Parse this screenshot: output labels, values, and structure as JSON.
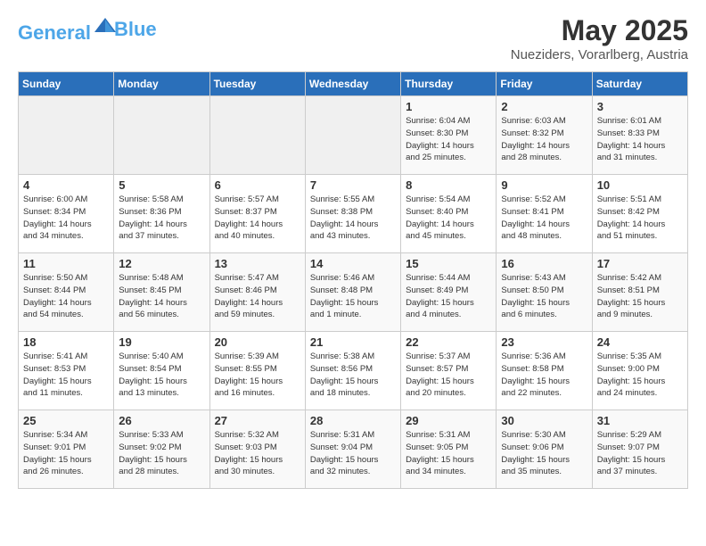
{
  "header": {
    "logo_line1": "General",
    "logo_line2": "Blue",
    "month": "May 2025",
    "location": "Nueziders, Vorarlberg, Austria"
  },
  "weekdays": [
    "Sunday",
    "Monday",
    "Tuesday",
    "Wednesday",
    "Thursday",
    "Friday",
    "Saturday"
  ],
  "weeks": [
    [
      {
        "day": "",
        "info": ""
      },
      {
        "day": "",
        "info": ""
      },
      {
        "day": "",
        "info": ""
      },
      {
        "day": "",
        "info": ""
      },
      {
        "day": "1",
        "info": "Sunrise: 6:04 AM\nSunset: 8:30 PM\nDaylight: 14 hours\nand 25 minutes."
      },
      {
        "day": "2",
        "info": "Sunrise: 6:03 AM\nSunset: 8:32 PM\nDaylight: 14 hours\nand 28 minutes."
      },
      {
        "day": "3",
        "info": "Sunrise: 6:01 AM\nSunset: 8:33 PM\nDaylight: 14 hours\nand 31 minutes."
      }
    ],
    [
      {
        "day": "4",
        "info": "Sunrise: 6:00 AM\nSunset: 8:34 PM\nDaylight: 14 hours\nand 34 minutes."
      },
      {
        "day": "5",
        "info": "Sunrise: 5:58 AM\nSunset: 8:36 PM\nDaylight: 14 hours\nand 37 minutes."
      },
      {
        "day": "6",
        "info": "Sunrise: 5:57 AM\nSunset: 8:37 PM\nDaylight: 14 hours\nand 40 minutes."
      },
      {
        "day": "7",
        "info": "Sunrise: 5:55 AM\nSunset: 8:38 PM\nDaylight: 14 hours\nand 43 minutes."
      },
      {
        "day": "8",
        "info": "Sunrise: 5:54 AM\nSunset: 8:40 PM\nDaylight: 14 hours\nand 45 minutes."
      },
      {
        "day": "9",
        "info": "Sunrise: 5:52 AM\nSunset: 8:41 PM\nDaylight: 14 hours\nand 48 minutes."
      },
      {
        "day": "10",
        "info": "Sunrise: 5:51 AM\nSunset: 8:42 PM\nDaylight: 14 hours\nand 51 minutes."
      }
    ],
    [
      {
        "day": "11",
        "info": "Sunrise: 5:50 AM\nSunset: 8:44 PM\nDaylight: 14 hours\nand 54 minutes."
      },
      {
        "day": "12",
        "info": "Sunrise: 5:48 AM\nSunset: 8:45 PM\nDaylight: 14 hours\nand 56 minutes."
      },
      {
        "day": "13",
        "info": "Sunrise: 5:47 AM\nSunset: 8:46 PM\nDaylight: 14 hours\nand 59 minutes."
      },
      {
        "day": "14",
        "info": "Sunrise: 5:46 AM\nSunset: 8:48 PM\nDaylight: 15 hours\nand 1 minute."
      },
      {
        "day": "15",
        "info": "Sunrise: 5:44 AM\nSunset: 8:49 PM\nDaylight: 15 hours\nand 4 minutes."
      },
      {
        "day": "16",
        "info": "Sunrise: 5:43 AM\nSunset: 8:50 PM\nDaylight: 15 hours\nand 6 minutes."
      },
      {
        "day": "17",
        "info": "Sunrise: 5:42 AM\nSunset: 8:51 PM\nDaylight: 15 hours\nand 9 minutes."
      }
    ],
    [
      {
        "day": "18",
        "info": "Sunrise: 5:41 AM\nSunset: 8:53 PM\nDaylight: 15 hours\nand 11 minutes."
      },
      {
        "day": "19",
        "info": "Sunrise: 5:40 AM\nSunset: 8:54 PM\nDaylight: 15 hours\nand 13 minutes."
      },
      {
        "day": "20",
        "info": "Sunrise: 5:39 AM\nSunset: 8:55 PM\nDaylight: 15 hours\nand 16 minutes."
      },
      {
        "day": "21",
        "info": "Sunrise: 5:38 AM\nSunset: 8:56 PM\nDaylight: 15 hours\nand 18 minutes."
      },
      {
        "day": "22",
        "info": "Sunrise: 5:37 AM\nSunset: 8:57 PM\nDaylight: 15 hours\nand 20 minutes."
      },
      {
        "day": "23",
        "info": "Sunrise: 5:36 AM\nSunset: 8:58 PM\nDaylight: 15 hours\nand 22 minutes."
      },
      {
        "day": "24",
        "info": "Sunrise: 5:35 AM\nSunset: 9:00 PM\nDaylight: 15 hours\nand 24 minutes."
      }
    ],
    [
      {
        "day": "25",
        "info": "Sunrise: 5:34 AM\nSunset: 9:01 PM\nDaylight: 15 hours\nand 26 minutes."
      },
      {
        "day": "26",
        "info": "Sunrise: 5:33 AM\nSunset: 9:02 PM\nDaylight: 15 hours\nand 28 minutes."
      },
      {
        "day": "27",
        "info": "Sunrise: 5:32 AM\nSunset: 9:03 PM\nDaylight: 15 hours\nand 30 minutes."
      },
      {
        "day": "28",
        "info": "Sunrise: 5:31 AM\nSunset: 9:04 PM\nDaylight: 15 hours\nand 32 minutes."
      },
      {
        "day": "29",
        "info": "Sunrise: 5:31 AM\nSunset: 9:05 PM\nDaylight: 15 hours\nand 34 minutes."
      },
      {
        "day": "30",
        "info": "Sunrise: 5:30 AM\nSunset: 9:06 PM\nDaylight: 15 hours\nand 35 minutes."
      },
      {
        "day": "31",
        "info": "Sunrise: 5:29 AM\nSunset: 9:07 PM\nDaylight: 15 hours\nand 37 minutes."
      }
    ]
  ]
}
